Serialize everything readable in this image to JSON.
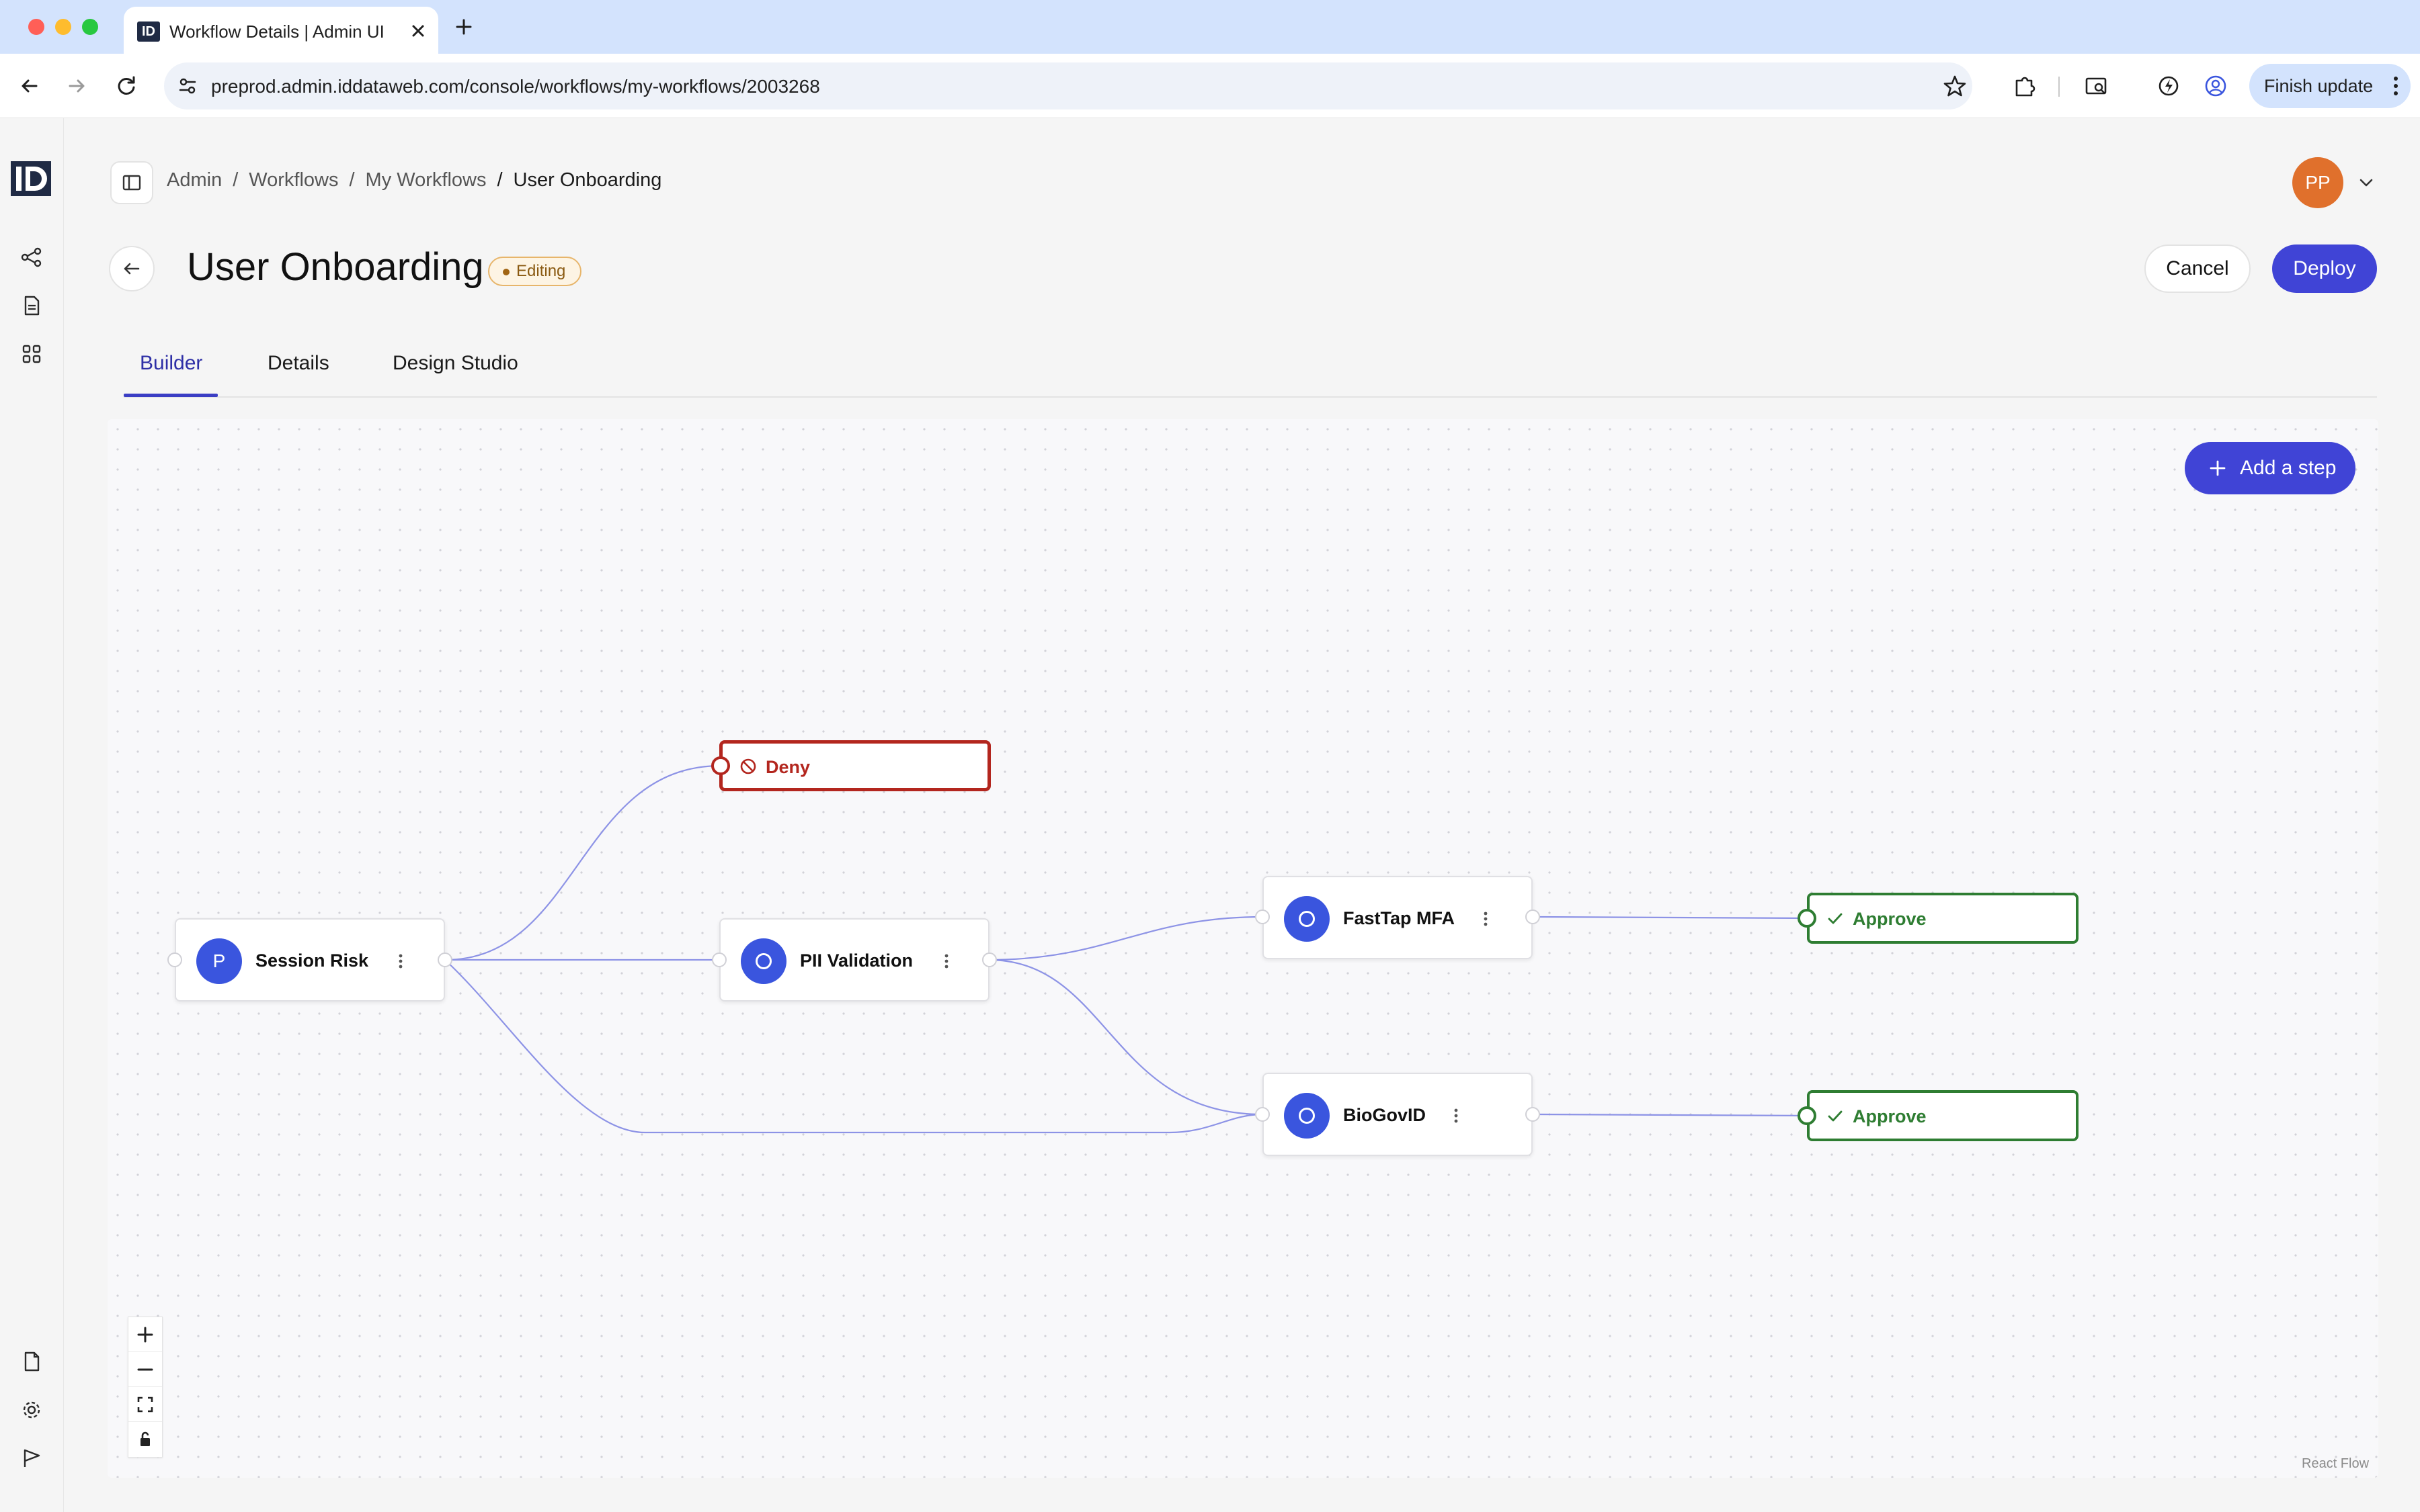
{
  "browser": {
    "tab_title": "Workflow Details | Admin UI",
    "favicon_text": "ID",
    "url": "preprod.admin.iddataweb.com/console/workflows/my-workflows/2003268",
    "finish_update_label": "Finish update"
  },
  "app": {
    "logo_text": "ID",
    "breadcrumb": {
      "items": [
        "Admin",
        "Workflows",
        "My Workflows",
        "User Onboarding"
      ],
      "separator": "/"
    },
    "user": {
      "initials": "PP"
    },
    "page": {
      "title": "User Onboarding",
      "status_badge": "Editing",
      "cancel_label": "Cancel",
      "deploy_label": "Deploy"
    },
    "tabs": [
      {
        "label": "Builder",
        "active": true
      },
      {
        "label": "Details",
        "active": false
      },
      {
        "label": "Design Studio",
        "active": false
      }
    ]
  },
  "canvas": {
    "add_step_label": "Add a step",
    "attribution": "React Flow",
    "nodes": [
      {
        "id": "session-risk",
        "label": "Session Risk",
        "icon_text": "P"
      },
      {
        "id": "pii-validation",
        "label": "PII Validation",
        "icon_text": ""
      },
      {
        "id": "fasttap-mfa",
        "label": "FastTap MFA",
        "icon_text": ""
      },
      {
        "id": "biogovid",
        "label": "BioGovID",
        "icon_text": ""
      }
    ],
    "outcomes": [
      {
        "id": "deny",
        "label": "Deny",
        "type": "deny"
      },
      {
        "id": "approve-1",
        "label": "Approve",
        "type": "approve"
      },
      {
        "id": "approve-2",
        "label": "Approve",
        "type": "approve"
      }
    ]
  },
  "colors": {
    "accent": "#4044d6",
    "node_icon": "#3a55de",
    "deny": "#b3261e",
    "approve": "#2e7d32",
    "avatar": "#e0702c",
    "badge_border": "#e7b56b",
    "edge": "#8d93e6"
  },
  "icons": {
    "tab_close": "close-icon",
    "new_tab": "plus-icon",
    "nav_back": "arrow-left-icon",
    "nav_forward": "arrow-right-icon",
    "reload": "reload-icon",
    "site_info": "tune-icon",
    "bookmark": "star-icon",
    "extensions": "puzzle-icon",
    "profile": "person-circle-icon",
    "rail_workflows": "workflow-icon",
    "rail_documents": "document-icon",
    "rail_apps": "grid-icon",
    "rail_docs": "file-icon",
    "rail_settings": "gear-icon",
    "rail_release": "flag-icon",
    "zoom_in": "plus-icon",
    "zoom_out": "minus-icon",
    "fit_view": "fit-view-icon",
    "lock": "lock-icon"
  }
}
